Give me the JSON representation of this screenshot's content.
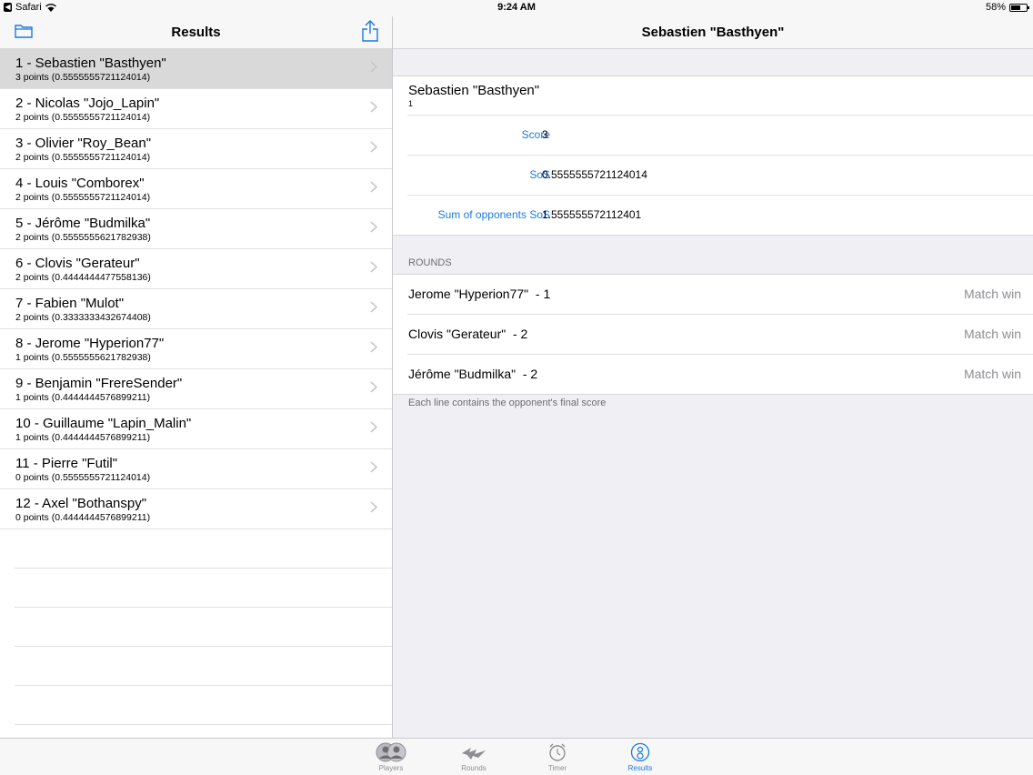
{
  "status_bar": {
    "carrier": "Safari",
    "time": "9:24 AM",
    "battery": "58%"
  },
  "master": {
    "title": "Results",
    "rows": [
      {
        "name": "1 - Sebastien \"Basthyen\"",
        "points": "3 points (0.5555555721124014)",
        "selected": true
      },
      {
        "name": "2 - Nicolas \"Jojo_Lapin\"",
        "points": "2 points (0.5555555721124014)"
      },
      {
        "name": "3 - Olivier \"Roy_Bean\"",
        "points": "2 points (0.5555555721124014)"
      },
      {
        "name": "4 - Louis \"Comborex\"",
        "points": "2 points (0.5555555721124014)"
      },
      {
        "name": "5 - Jérôme \"Budmilka\"",
        "points": "2 points (0.5555555621782938)"
      },
      {
        "name": "6 - Clovis \"Gerateur\"",
        "points": "2 points (0.4444444477558136)"
      },
      {
        "name": "7 - Fabien \"Mulot\"",
        "points": "2 points (0.3333333432674408)"
      },
      {
        "name": "8 - Jerome \"Hyperion77\"",
        "points": "1 points (0.5555555621782938)"
      },
      {
        "name": "9 - Benjamin \"FrereSender\"",
        "points": "1 points (0.4444444576899211)"
      },
      {
        "name": "10 - Guillaume \"Lapin_Malin\"",
        "points": "1 points (0.4444444576899211)"
      },
      {
        "name": "11 - Pierre \"Futil\"",
        "points": "0 points (0.5555555721124014)"
      },
      {
        "name": "12 - Axel \"Bothanspy\"",
        "points": "0 points (0.4444444576899211)"
      }
    ]
  },
  "detail": {
    "title": "Sebastien \"Basthyen\"",
    "player_name": "Sebastien \"Basthyen\"",
    "player_rank": "1",
    "stats": [
      {
        "label": "Score",
        "value": "3"
      },
      {
        "label": "SoS",
        "value": "0.5555555721124014"
      },
      {
        "label": "Sum of opponents SoS",
        "value": "1.555555572112401"
      }
    ],
    "rounds_header": "ROUNDS",
    "rounds": [
      {
        "opponent": "Jerome \"Hyperion77\"  - 1",
        "result": "Match win"
      },
      {
        "opponent": "Clovis \"Gerateur\"  - 2",
        "result": "Match win"
      },
      {
        "opponent": "Jérôme \"Budmilka\"  - 2",
        "result": "Match win"
      }
    ],
    "rounds_footer": "Each line contains the opponent's final score"
  },
  "tabs": [
    {
      "label": "Players",
      "icon": "players-icon",
      "active": false
    },
    {
      "label": "Rounds",
      "icon": "rounds-icon",
      "active": false
    },
    {
      "label": "Timer",
      "icon": "timer-icon",
      "active": false
    },
    {
      "label": "Results",
      "icon": "results-icon",
      "active": true
    }
  ],
  "colors": {
    "accent": "#1a7ae0",
    "selected_row": "#d9d9d9",
    "background": "#efeff4"
  }
}
